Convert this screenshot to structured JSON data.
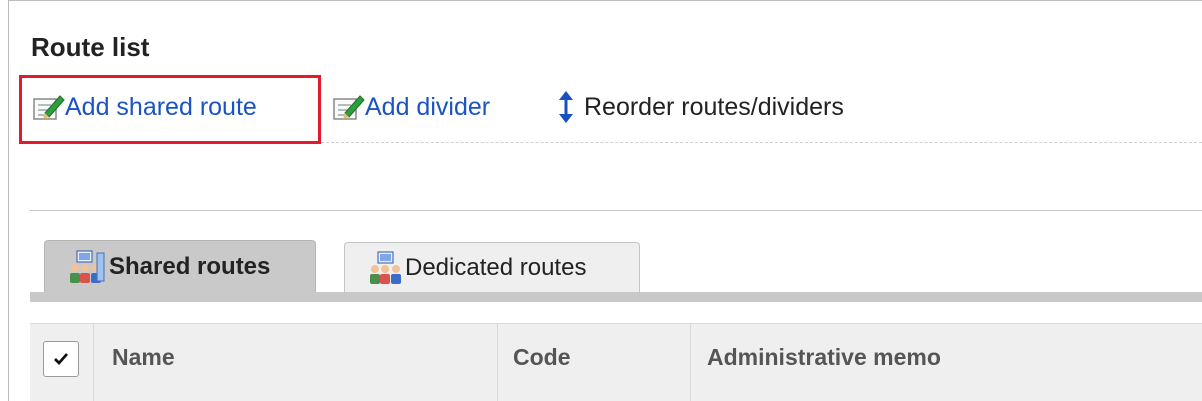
{
  "page": {
    "title": "Route list"
  },
  "toolbar": {
    "add_shared_route": "Add shared route",
    "add_divider": "Add divider",
    "reorder": "Reorder routes/dividers"
  },
  "tabs": [
    {
      "label": "Shared routes",
      "active": true
    },
    {
      "label": "Dedicated routes",
      "active": false
    }
  ],
  "table": {
    "select_all_checked": true,
    "columns": [
      "Name",
      "Code",
      "Administrative memo"
    ]
  },
  "colors": {
    "link": "#1a54c4",
    "highlight": "#e3192e",
    "tab_active_bg": "#c9c9c9",
    "header_bg": "#efefef"
  },
  "icons": [
    "edit-icon",
    "reorder-icon",
    "users-group-icon",
    "checkmark-icon"
  ]
}
